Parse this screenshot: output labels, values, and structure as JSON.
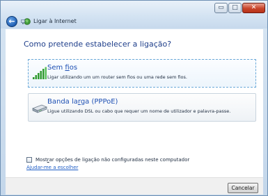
{
  "window": {
    "title": "Ligar à Internet",
    "back_icon": "←",
    "minimize_icon": "▭",
    "maximize_icon": "□",
    "close_icon": "✕"
  },
  "heading": "Como pretende estabelecer a ligação?",
  "options": [
    {
      "title_prefix": "Sem ",
      "title_underlined": "f",
      "title_suffix": "ios",
      "description": "Ligar utilizando um um router sem fios ou uma rede sem fios.",
      "icon": "wireless-signal-icon",
      "selected": true
    },
    {
      "title_prefix": "Banda la",
      "title_underlined": "r",
      "title_suffix": "ga (PPPoE)",
      "description": "Ligue utilizando DSL ou cabo que requer um nome de utilizador e palavra-passe.",
      "icon": "broadband-modem-icon",
      "selected": false
    }
  ],
  "show_unconfigured": {
    "label_prefix": "Most",
    "label_underlined": "r",
    "label_suffix": "ar opções de ligação não configuradas neste computador",
    "checked": false
  },
  "help_link": "Ajudar-me a escolher",
  "cancel_label": "Cancelar",
  "colors": {
    "heading": "#1e3e8a",
    "option_title": "#1d4fb3",
    "link": "#1e5dc6",
    "close_button": "#c8442a"
  }
}
